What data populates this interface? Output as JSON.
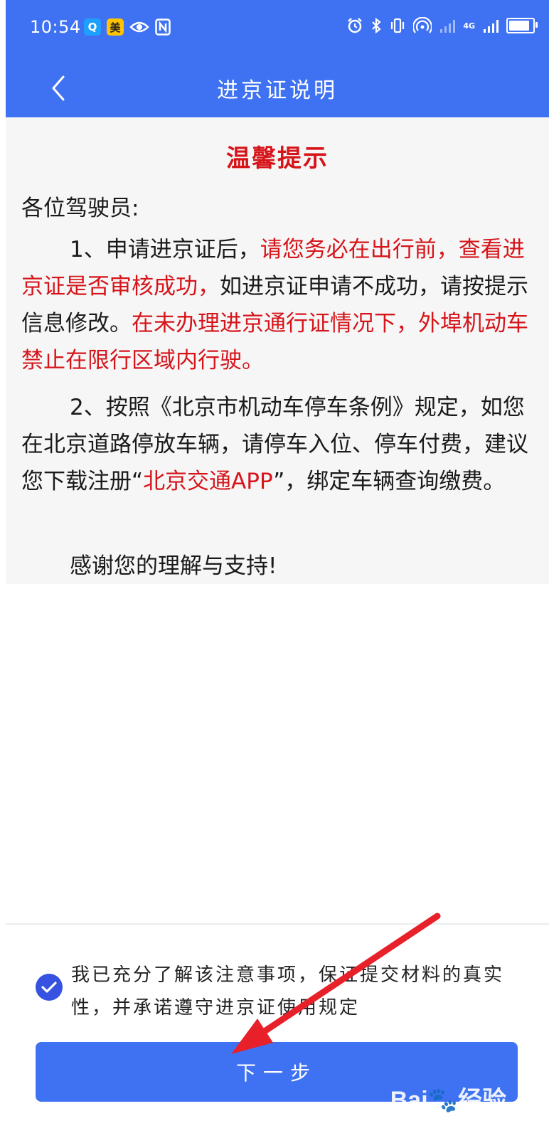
{
  "status_bar": {
    "time": "10:54",
    "left_badges": [
      {
        "icon": "search-app-icon",
        "glyph": "Q",
        "bg": "#1ea0ff",
        "color": "#ffffff"
      },
      {
        "icon": "meituan-app-icon",
        "glyph": "美",
        "bg": "#ffc300",
        "color": "#222222"
      }
    ],
    "network_label": "4G"
  },
  "navbar": {
    "title": "进京证说明"
  },
  "notice": {
    "title": "温馨提示",
    "greeting": "各位驾驶员:",
    "p1_a": "1、申请进京证后，",
    "p1_b": "请您务必在出行前，查看进京证是否审核成功，",
    "p1_c": "如进京证申请不成功，请按提示信息修改。",
    "p1_d": "在未办理进京通行证情况下，外埠机动车禁止在限行区域内行驶。",
    "p2_a": "2、按照《北京市机动车停车条例》规定，如您在北京道路停放车辆，请停车入位、停车付费，建议您下载注册“",
    "p2_b": "北京交通APP",
    "p2_c": "”，绑定车辆查询缴费。",
    "p3": "感谢您的理解与支持!"
  },
  "agreement": {
    "checked": true,
    "text": "我已充分了解该注意事项，保证提交材料的真实性，并承诺遵守进京证使用规定"
  },
  "next_button": {
    "label": "下一步"
  },
  "watermark": {
    "logo": "Bai🐾经验",
    "url": "jingyan.baidu.com"
  },
  "colors": {
    "primary": "#3f72f2",
    "alert_red": "#d6141a",
    "checkbox": "#3552e0",
    "annotation_arrow": "#e8202a"
  }
}
